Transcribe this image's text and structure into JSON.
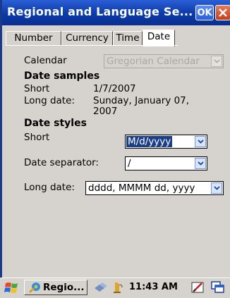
{
  "window": {
    "title": "Regional and Language Se...",
    "ok_label": "OK"
  },
  "tabs": [
    {
      "label": "Number"
    },
    {
      "label": "Currency"
    },
    {
      "label": "Time"
    },
    {
      "label": "Date",
      "active": true
    }
  ],
  "calendar": {
    "label": "Calendar",
    "value": "Gregorian Calendar",
    "disabled": true
  },
  "date_samples": {
    "heading": "Date samples",
    "short_label": "Short",
    "short_value": "1/7/2007",
    "long_label": "Long date:",
    "long_value_line1": "Sunday, January 07,",
    "long_value_line2": "2007"
  },
  "date_styles": {
    "heading": "Date styles",
    "short_label": "Short",
    "short_value": "M/d/yyyy",
    "separator_label": "Date separator:",
    "separator_value": "/",
    "long_label": "Long date:",
    "long_value": "dddd, MMMM dd, yyyy"
  },
  "taskbar": {
    "task_label": "Regio...",
    "clock": "11:43 AM"
  },
  "colors": {
    "title_bar": "#0b3aa8",
    "selection": "#1c3f8c",
    "window_bg": "#d6d3ce"
  }
}
